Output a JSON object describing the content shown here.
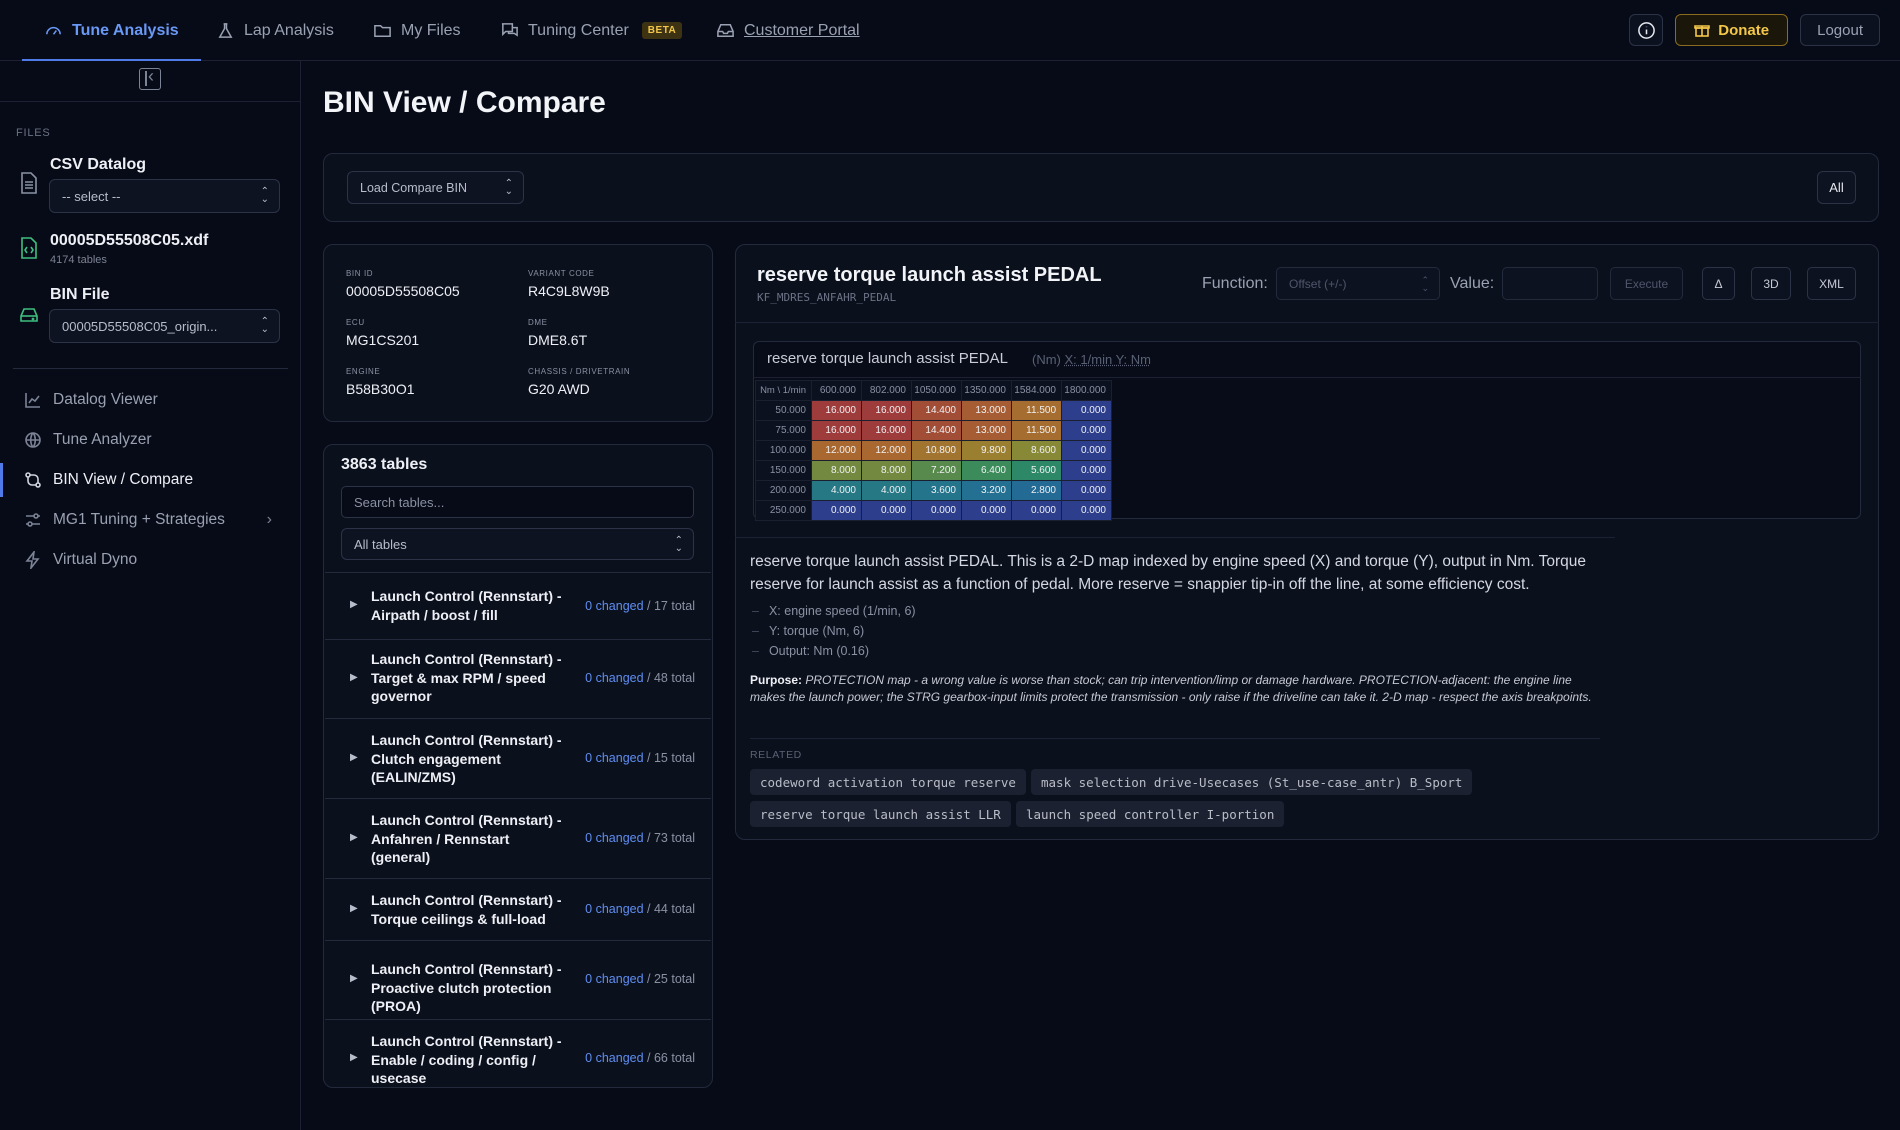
{
  "nav": {
    "tabs": [
      {
        "label": "Tune Analysis",
        "icon": "gauge-icon"
      },
      {
        "label": "Lap Analysis",
        "icon": "flask-icon"
      },
      {
        "label": "My Files",
        "icon": "folder-icon"
      },
      {
        "label": "Tuning Center",
        "icon": "chat-icon",
        "badge": "BETA"
      },
      {
        "label": "Customer Portal",
        "icon": "inbox-icon"
      }
    ],
    "donate_label": "Donate",
    "logout_label": "Logout"
  },
  "sidebar": {
    "files_label": "FILES",
    "csv": {
      "title": "CSV Datalog",
      "select_value": "-- select --"
    },
    "xdf": {
      "title": "00005D55508C05.xdf",
      "sub": "4174 tables"
    },
    "bin": {
      "title": "BIN File",
      "select_value": "00005D55508C05_origin..."
    },
    "items": [
      {
        "label": "Datalog Viewer",
        "icon": "chart-icon"
      },
      {
        "label": "Tune Analyzer",
        "icon": "globe-icon"
      },
      {
        "label": "BIN View / Compare",
        "icon": "compare-icon"
      },
      {
        "label": "MG1 Tuning + Strategies",
        "icon": "sliders-icon"
      },
      {
        "label": "Virtual Dyno",
        "icon": "bolt-icon"
      }
    ]
  },
  "page_title": "BIN View / Compare",
  "compare": {
    "select_label": "Load Compare BIN",
    "all_label": "All"
  },
  "meta": {
    "bin_id_label": "BIN ID",
    "bin_id": "00005D55508C05",
    "variant_label": "VARIANT CODE",
    "variant": "R4C9L8W9B",
    "ecu_label": "ECU",
    "ecu": "MG1CS201",
    "dme_label": "DME",
    "dme": "DME8.6T",
    "engine_label": "ENGINE",
    "engine": "B58B30O1",
    "chassis_label": "CHASSIS / DRIVETRAIN",
    "chassis": "G20 AWD"
  },
  "tables": {
    "count_title": "3863 tables",
    "search_placeholder": "Search tables...",
    "filter_value": "All tables",
    "groups": [
      {
        "name": "Launch Control (Rennstart) - Airpath / boost / fill",
        "changed": "0 changed",
        "total": " / 17 total"
      },
      {
        "name": "Launch Control (Rennstart) - Target & max RPM / speed governor",
        "changed": "0 changed",
        "total": " / 48 total"
      },
      {
        "name": "Launch Control (Rennstart) - Clutch engagement (EALIN/ZMS)",
        "changed": "0 changed",
        "total": " / 15 total"
      },
      {
        "name": "Launch Control (Rennstart) - Anfahren / Rennstart (general)",
        "changed": "0 changed",
        "total": " / 73 total"
      },
      {
        "name": "Launch Control (Rennstart) - Torque ceilings & full-load",
        "changed": "0 changed",
        "total": " / 44 total"
      },
      {
        "name": "Launch Control (Rennstart) - Proactive clutch protection (PROA)",
        "changed": "0 changed",
        "total": " / 25 total"
      },
      {
        "name": "Launch Control (Rennstart) - Enable / coding / config / usecase",
        "changed": "0 changed",
        "total": " / 66 total"
      }
    ]
  },
  "detail": {
    "title": "reserve torque launch assist PEDAL",
    "symbol": "KF_MDRES_ANFAHR_PEDAL",
    "function_label": "Function:",
    "function_value": "Offset (+/-)",
    "value_label": "Value:",
    "execute_label": "Execute",
    "delta_label": "Δ",
    "threed_label": "3D",
    "xml_label": "XML",
    "map_title": "reserve torque launch assist PEDAL",
    "map_units_prefix": "(Nm) ",
    "map_units_x": "X: 1/min",
    "map_units_y": " Y: Nm",
    "corner_label": "Nm \\ 1/min",
    "x_axis": [
      "600.000",
      "802.000",
      "1050.000",
      "1350.000",
      "1584.000",
      "1800.000"
    ],
    "y_axis": [
      "50.000",
      "75.000",
      "100.000",
      "150.000",
      "200.000",
      "250.000"
    ],
    "cells": [
      [
        "16.000",
        "16.000",
        "14.400",
        "13.000",
        "11.500",
        "0.000"
      ],
      [
        "16.000",
        "16.000",
        "14.400",
        "13.000",
        "11.500",
        "0.000"
      ],
      [
        "12.000",
        "12.000",
        "10.800",
        "9.800",
        "8.600",
        "0.000"
      ],
      [
        "8.000",
        "8.000",
        "7.200",
        "6.400",
        "5.600",
        "0.000"
      ],
      [
        "4.000",
        "4.000",
        "3.600",
        "3.200",
        "2.800",
        "0.000"
      ],
      [
        "0.000",
        "0.000",
        "0.000",
        "0.000",
        "0.000",
        "0.000"
      ]
    ],
    "description": "reserve torque launch assist PEDAL. This is a 2-D map indexed by engine speed (X) and torque (Y), output in Nm. Torque reserve for launch assist as a function of pedal. More reserve = snappier tip-in off the line, at some efficiency cost.",
    "axes": [
      "X: engine speed (1/min, 6)",
      "Y: torque (Nm, 6)",
      "Output: Nm (0.16)"
    ],
    "purpose_label": "Purpose:",
    "purpose_text": " PROTECTION map - a wrong value is worse than stock; can trip intervention/limp or damage hardware. PROTECTION-adjacent: the engine line makes the launch power; the STRG gearbox-input limits protect the transmission - only raise if the driveline can take it. 2-D map - respect the axis breakpoints.",
    "related_label": "RELATED",
    "related": [
      "codeword activation torque reserve",
      "mask selection drive-Usecases (St_use-case_antr) B_Sport",
      "reserve torque launch assist LLR",
      "launch speed controller I-portion"
    ]
  },
  "colors": {
    "accent": "#4f7be8",
    "gold": "#f3c74a",
    "changed": "#5f8ef0"
  }
}
